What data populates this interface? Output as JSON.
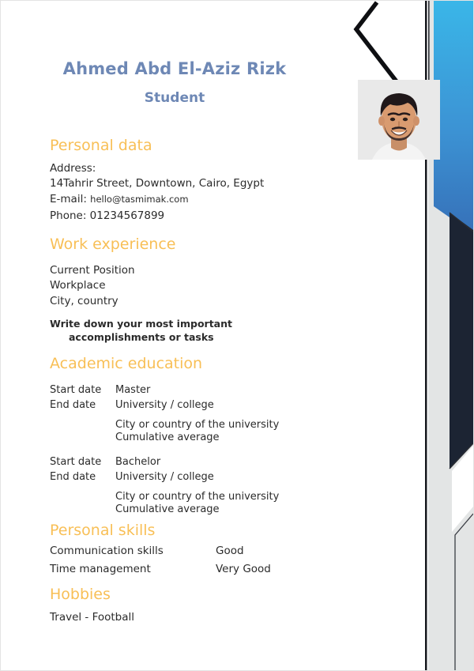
{
  "header": {
    "name": "Ahmed Abd El-Aziz Rizk",
    "role": "Student"
  },
  "photo": {
    "alt_name": "portrait-photo"
  },
  "sections": {
    "personal_data": {
      "title": "Personal data",
      "address_label": "Address:",
      "address_value": "14Tahrir Street, Downtown, Cairo, Egypt",
      "email_label": "E-mail:",
      "email_value": "hello@tasmimak.com",
      "phone_line": "Phone: 01234567899"
    },
    "work_experience": {
      "title": "Work experience",
      "position": "Current Position",
      "workplace": "Workplace",
      "location": "City, country",
      "accomplishments_line1": "Write down your most important",
      "accomplishments_line2": "accomplishments or tasks"
    },
    "academic_education": {
      "title": "Academic education",
      "entries": [
        {
          "start_label": "Start date",
          "end_label": "End date",
          "degree": "Master",
          "institution": "University / college",
          "city": "City or country of the university",
          "average": "Cumulative average"
        },
        {
          "start_label": "Start date",
          "end_label": "End date",
          "degree": "Bachelor",
          "institution": "University / college",
          "city": "City or country of the university",
          "average": "Cumulative average"
        }
      ]
    },
    "personal_skills": {
      "title": "Personal skills",
      "items": [
        {
          "name": "Communication skills",
          "rating": "Good"
        },
        {
          "name": "Time management",
          "rating": "Very Good"
        }
      ]
    },
    "hobbies": {
      "title": "Hobbies",
      "value": "Travel - Football"
    }
  },
  "colors": {
    "name": "#6e88b5",
    "section_heading": "#f8bf56",
    "body_text": "#2b2b2b",
    "accent_cyan": "#3ab6e8",
    "accent_blue": "#3670b8",
    "dark_navy": "#1c2433",
    "light_gray": "#e3e5e5"
  }
}
